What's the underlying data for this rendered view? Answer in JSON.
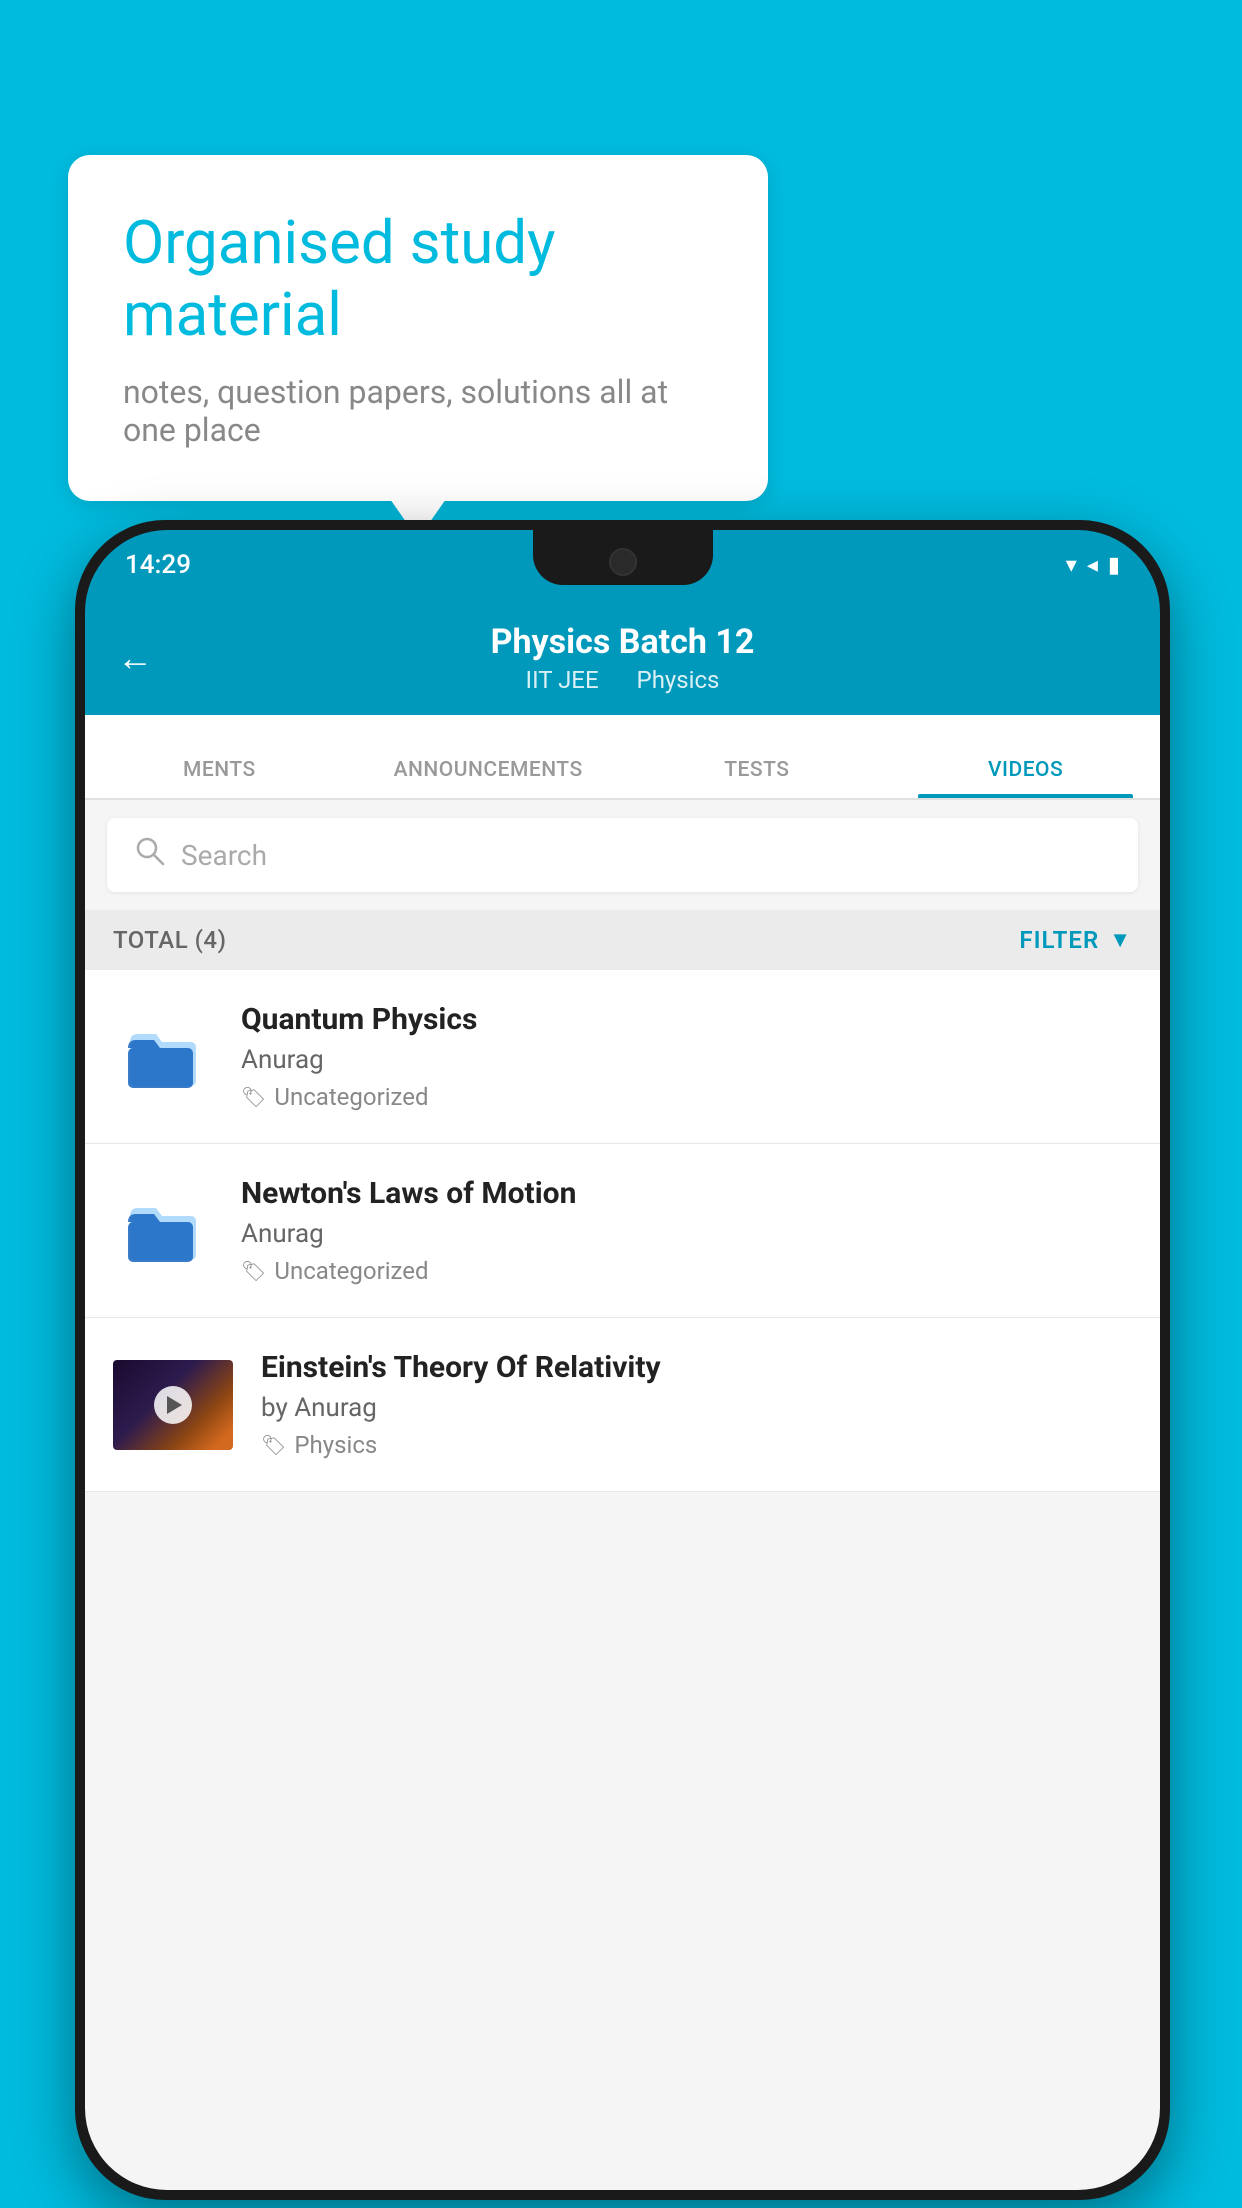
{
  "background": {
    "color": "#00BBDE"
  },
  "speech_bubble": {
    "title": "Organised study material",
    "subtitle": "notes, question papers, solutions all at one place"
  },
  "phone": {
    "status_bar": {
      "time": "14:29"
    },
    "header": {
      "back_label": "←",
      "title": "Physics Batch 12",
      "subtitle_left": "IIT JEE",
      "subtitle_right": "Physics"
    },
    "tabs": [
      {
        "label": "MENTS",
        "active": false
      },
      {
        "label": "ANNOUNCEMENTS",
        "active": false
      },
      {
        "label": "TESTS",
        "active": false
      },
      {
        "label": "VIDEOS",
        "active": true
      }
    ],
    "search": {
      "placeholder": "Search"
    },
    "filter_bar": {
      "total_label": "TOTAL (4)",
      "filter_label": "FILTER"
    },
    "videos": [
      {
        "id": 1,
        "title": "Quantum Physics",
        "author": "Anurag",
        "tag": "Uncategorized",
        "has_thumbnail": false
      },
      {
        "id": 2,
        "title": "Newton's Laws of Motion",
        "author": "Anurag",
        "tag": "Uncategorized",
        "has_thumbnail": false
      },
      {
        "id": 3,
        "title": "Einstein's Theory Of Relativity",
        "author": "by Anurag",
        "tag": "Physics",
        "has_thumbnail": true
      }
    ]
  }
}
